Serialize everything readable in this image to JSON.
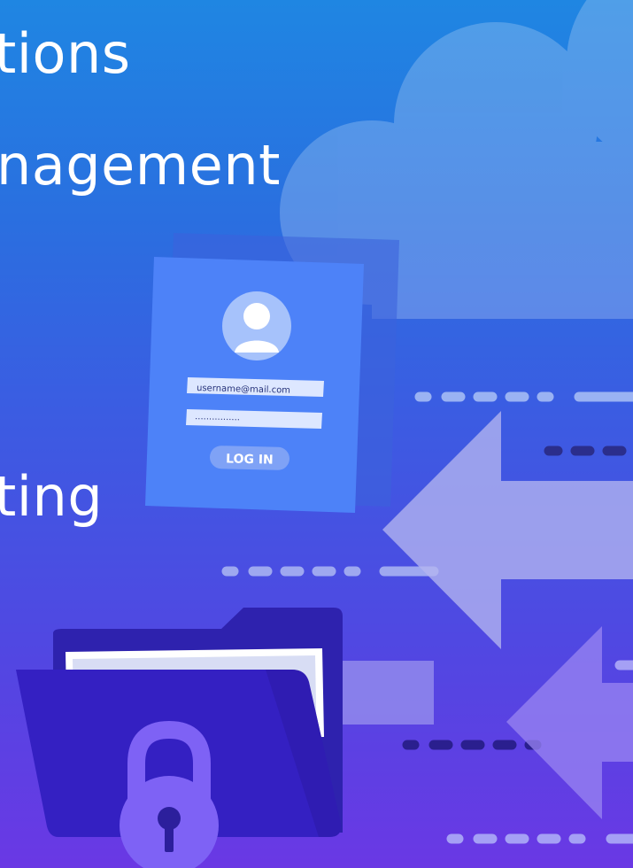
{
  "headlines": {
    "line1": "tions",
    "line2": "nagement",
    "line3": "ting"
  },
  "login_card": {
    "username_value": "username@mail.com",
    "password_mask": "················",
    "login_label": "LOG IN"
  },
  "icons": {
    "cloud": "cloud-icon",
    "user": "user-avatar-icon",
    "folder": "folder-icon",
    "lock": "padlock-icon",
    "arrows": "left-arrow-icon"
  },
  "colors": {
    "gradient_top": "#1f86e2",
    "gradient_bottom": "#6a38e4",
    "card": "#4c80f7",
    "folder": "#3523c4",
    "lock": "#7e62f5"
  }
}
